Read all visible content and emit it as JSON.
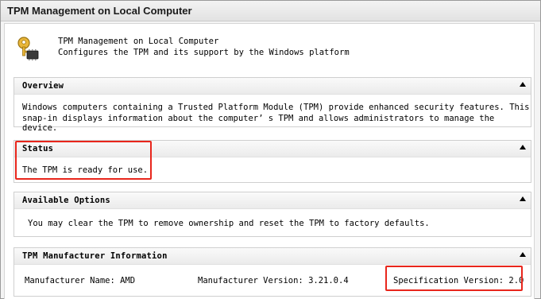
{
  "window": {
    "title": "TPM Management on Local Computer"
  },
  "header": {
    "title": "TPM Management on Local Computer",
    "description": "Configures the TPM and its support by the Windows platform",
    "icon": "key-chip-icon"
  },
  "sections": {
    "overview": {
      "title": "Overview",
      "lines": [
        "Windows computers containing a Trusted Platform Module (TPM) provide enhanced security features. This",
        "snap-in displays information about the computer’ s TPM and allows administrators to manage the device."
      ]
    },
    "status": {
      "title": "Status",
      "text": "The TPM is ready for use."
    },
    "available_options": {
      "title": "Available Options",
      "text": "You may clear the TPM to remove ownership and reset the TPM to factory defaults."
    },
    "manufacturer_info": {
      "title": "TPM Manufacturer Information",
      "manufacturer_name": "Manufacturer Name: AMD",
      "manufacturer_version": "Manufacturer Version: 3.21.0.4",
      "specification_version": "Specification Version: 2.0"
    }
  },
  "colors": {
    "highlight": "#e8261c",
    "section_border": "#cfcfcf"
  }
}
